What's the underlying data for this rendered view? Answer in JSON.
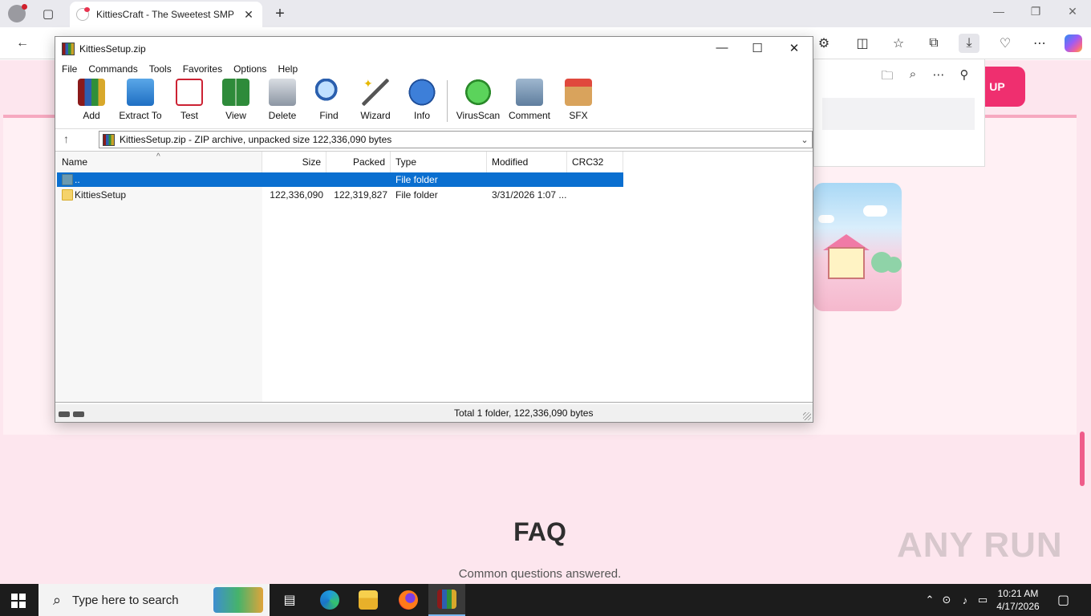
{
  "browser": {
    "tab_title": "KittiesCraft - The Sweetest SMP",
    "tab_close": "✕",
    "new_tab": "+"
  },
  "webpage": {
    "signup_label": "UP",
    "faq_title": "FAQ",
    "faq_subtitle": "Common questions answered.",
    "watermark": "ANY RUN"
  },
  "winrar": {
    "title": "KittiesSetup.zip",
    "menu": [
      "File",
      "Commands",
      "Tools",
      "Favorites",
      "Options",
      "Help"
    ],
    "toolbar": [
      "Add",
      "Extract To",
      "Test",
      "View",
      "Delete",
      "Find",
      "Wizard",
      "Info",
      "VirusScan",
      "Comment",
      "SFX"
    ],
    "path": "KittiesSetup.zip - ZIP archive, unpacked size 122,336,090 bytes",
    "columns": [
      "Name",
      "Size",
      "Packed",
      "Type",
      "Modified",
      "CRC32"
    ],
    "rows": [
      {
        "name": "..",
        "size": "",
        "packed": "",
        "type": "File folder",
        "modified": "",
        "crc": ""
      },
      {
        "name": "KittiesSetup",
        "size": "122,336,090",
        "packed": "122,319,827",
        "type": "File folder",
        "modified": "3/31/2026 1:07 ...",
        "crc": ""
      }
    ],
    "status": "Total 1 folder, 122,336,090 bytes"
  },
  "taskbar": {
    "search_placeholder": "Type here to search",
    "time": "10:21 AM",
    "date": "4/17/2026"
  },
  "colors": {
    "accent": "#0a6fd0",
    "brand_pink": "#ef2f6f",
    "page_bg": "#fde6ee"
  }
}
